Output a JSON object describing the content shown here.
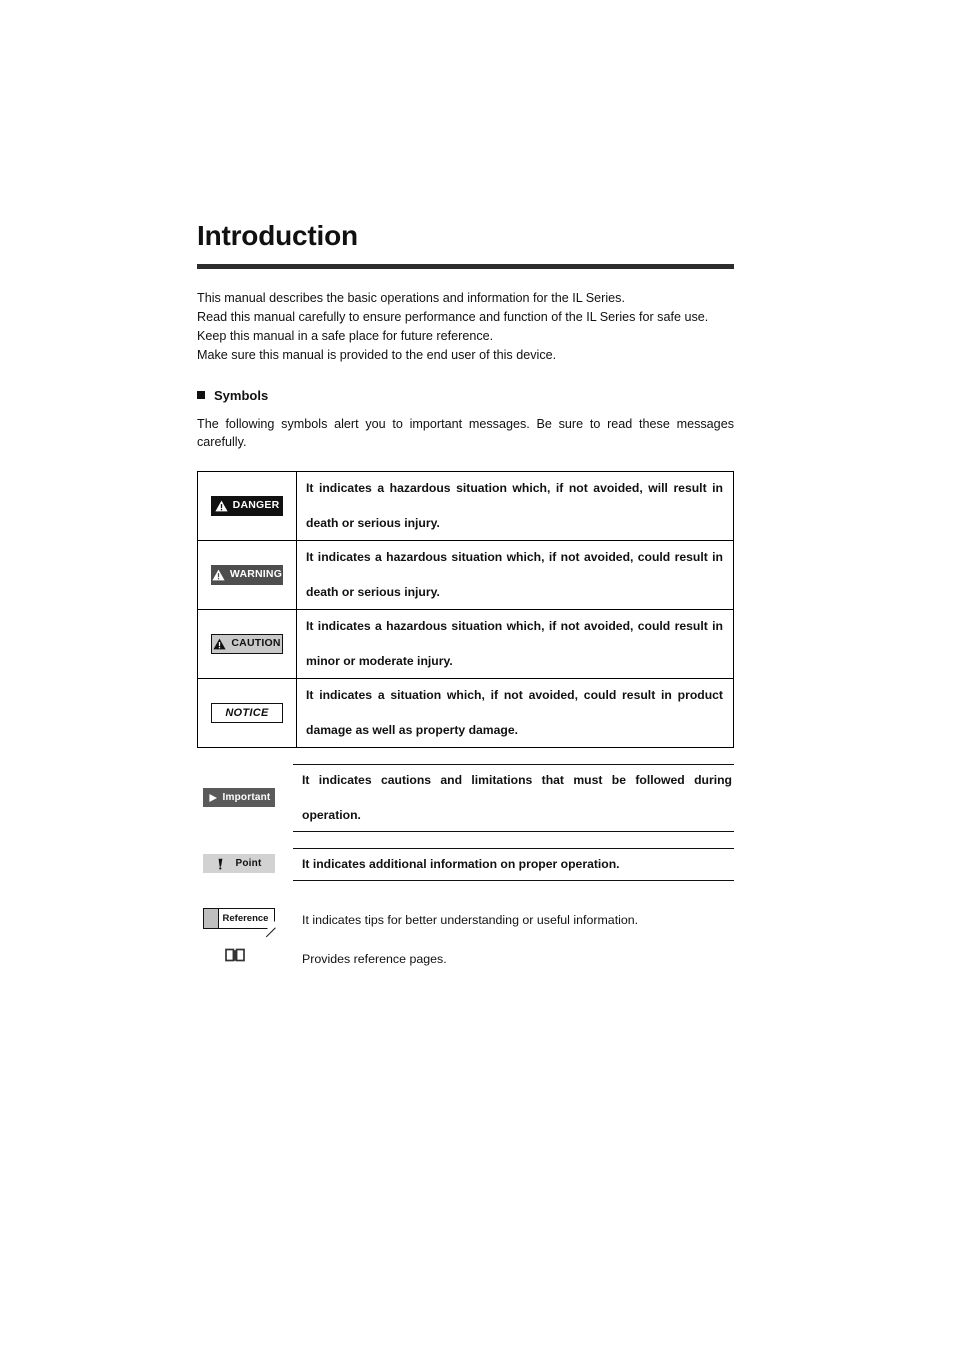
{
  "document": {
    "title": "Introduction",
    "intro_lines": [
      "This manual describes the basic operations and information for the IL Series.",
      "Read this manual carefully to ensure performance and function of the IL Series for safe use.",
      "Keep this manual in a safe place for future reference.",
      "Make sure this manual is provided to the end user of this device."
    ]
  },
  "symbols_section": {
    "heading": "Symbols",
    "bullet_icon": "filled-square-bullet",
    "description": "The following symbols alert you to important messages. Be sure to read these messages carefully."
  },
  "hazard_table": {
    "rows": [
      {
        "badge_label": "DANGER",
        "badge_icon": "warning-triangle-icon",
        "badge_style": "black-fill-white-text",
        "badge_bg": "#111111",
        "badge_fg": "#ffffff",
        "line1": "It indicates a hazardous situation which, if not avoided, will result in",
        "line2": "death or serious injury."
      },
      {
        "badge_label": "WARNING",
        "badge_icon": "warning-triangle-icon",
        "badge_style": "dark-gray-fill-white-text",
        "badge_bg": "#4e4e4e",
        "badge_fg": "#ffffff",
        "line1": "It indicates a hazardous situation which, if not avoided, could result in",
        "line2": "death or serious injury."
      },
      {
        "badge_label": "CAUTION",
        "badge_icon": "warning-triangle-icon",
        "badge_style": "light-gray-fill-black-text",
        "badge_bg": "#c9c9c9",
        "badge_fg": "#111111",
        "line1": "It indicates a hazardous situation which, if not avoided, could result in",
        "line2": "minor or moderate injury."
      },
      {
        "badge_label": "NOTICE",
        "badge_icon": "none",
        "badge_style": "white-fill-black-italic-text",
        "badge_bg": "#ffffff",
        "badge_fg": "#111111",
        "line1": "It indicates a situation which, if not avoided, could result in product",
        "line2": "damage as well as property damage."
      }
    ]
  },
  "note_rows": [
    {
      "badge_label": "Important",
      "badge_icon": "play-triangle-icon",
      "badge_bg": "#5a5a5a",
      "badge_fg": "#ffffff",
      "line1": "It indicates cautions and limitations that must be followed during",
      "line2": "operation."
    },
    {
      "badge_label": "Point",
      "badge_icon": "pen-nib-icon",
      "badge_bg": "#d2d2d2",
      "badge_fg": "#111111",
      "line1": "It indicates additional information on proper operation.",
      "line2": ""
    }
  ],
  "plain_rows": [
    {
      "badge_label": "Reference",
      "badge_icon": "reference-page-icon",
      "badge_bg": "#ffffff",
      "badge_fg": "#111111",
      "text": "It indicates tips for better understanding or useful information."
    },
    {
      "badge_label": "",
      "badge_icon": "open-book-icon",
      "badge_bg": "#ffffff",
      "badge_fg": "#111111",
      "text": "Provides reference pages."
    }
  ]
}
